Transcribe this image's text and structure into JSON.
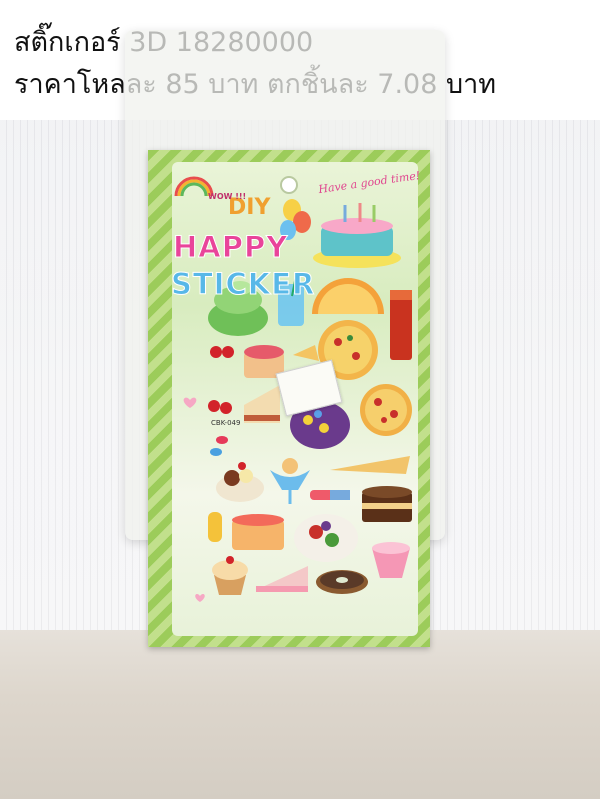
{
  "caption": {
    "line1": "สติ๊กเกอร์ 3D 18280000",
    "line2": "ราคาโหลละ 85 บาท ตกชิ้นละ 7.08 บาท"
  },
  "product": {
    "title_line1": "HAPPY",
    "title_line2": "STICKER",
    "badge_diy": "DIY",
    "badge_wow": "WOW !!!",
    "slogan": "Have a good time!",
    "code": "CBK-049"
  },
  "colors": {
    "card_green": "#9ccc5a",
    "title_pink": "#e9449a",
    "title_blue": "#58b8e8"
  }
}
